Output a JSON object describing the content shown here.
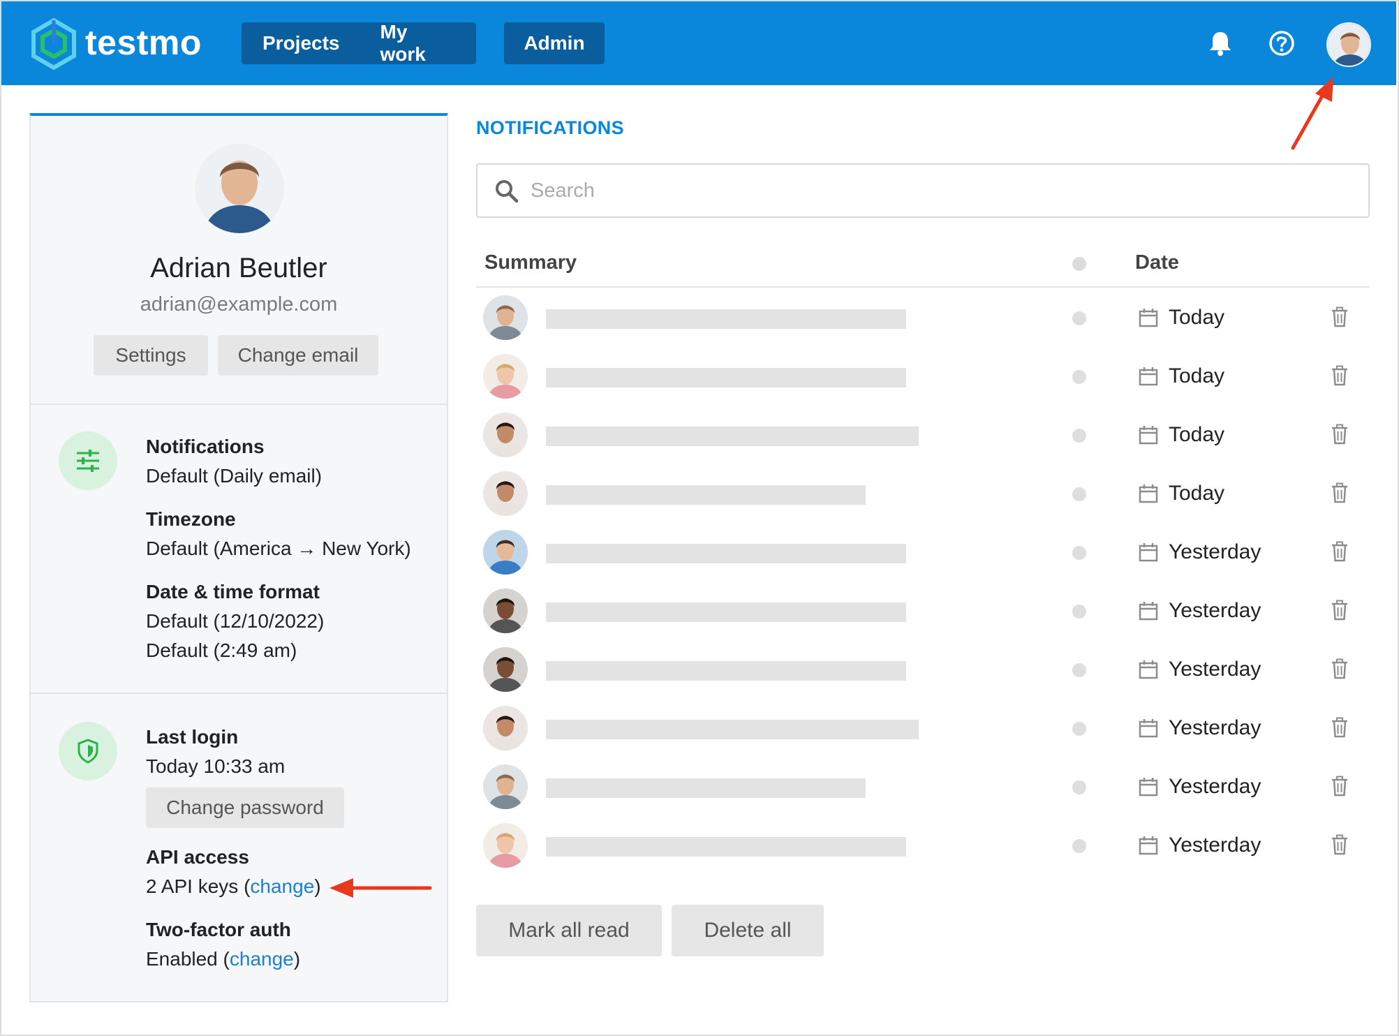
{
  "header": {
    "brand": "testmo",
    "nav": [
      {
        "label": "Projects"
      },
      {
        "label": "My work"
      }
    ],
    "admin_label": "Admin",
    "icons": [
      "bell-icon",
      "help-icon",
      "user-avatar"
    ],
    "color": "#0a87da"
  },
  "profile": {
    "name": "Adrian Beutler",
    "email": "adrian@example.com",
    "settings_label": "Settings",
    "change_email_label": "Change email"
  },
  "preferences": {
    "notifications_label": "Notifications",
    "notifications_value": "Default (Daily email)",
    "timezone_label": "Timezone",
    "timezone_value": "Default (America → New York)",
    "datetime_label": "Date & time format",
    "date_value": "Default (12/10/2022)",
    "time_value": "Default (2:49 am)"
  },
  "security": {
    "last_login_label": "Last login",
    "last_login_value": "Today 10:33 am",
    "change_password_label": "Change password",
    "api_label": "API access",
    "api_value_prefix": "2 API keys (",
    "api_link": "change",
    "api_value_suffix": ")",
    "twofa_label": "Two-factor auth",
    "twofa_value_prefix": "Enabled (",
    "twofa_link": "change",
    "twofa_value_suffix": ")"
  },
  "notifications": {
    "title": "NOTIFICATIONS",
    "search_placeholder": "Search",
    "columns": {
      "summary": "Summary",
      "date": "Date"
    },
    "rows": [
      {
        "date": "Today",
        "avatar": "man-beard"
      },
      {
        "date": "Today",
        "avatar": "woman-blonde"
      },
      {
        "date": "Today",
        "avatar": "woman-dark-hair"
      },
      {
        "date": "Today",
        "avatar": "woman-dark-hair"
      },
      {
        "date": "Yesterday",
        "avatar": "man-blue-shirt"
      },
      {
        "date": "Yesterday",
        "avatar": "man-dark-skin"
      },
      {
        "date": "Yesterday",
        "avatar": "man-dark-skin"
      },
      {
        "date": "Yesterday",
        "avatar": "woman-dark-hair"
      },
      {
        "date": "Yesterday",
        "avatar": "man-beard"
      },
      {
        "date": "Yesterday",
        "avatar": "woman-blonde"
      }
    ],
    "mark_all_read_label": "Mark all read",
    "delete_all_label": "Delete all"
  }
}
